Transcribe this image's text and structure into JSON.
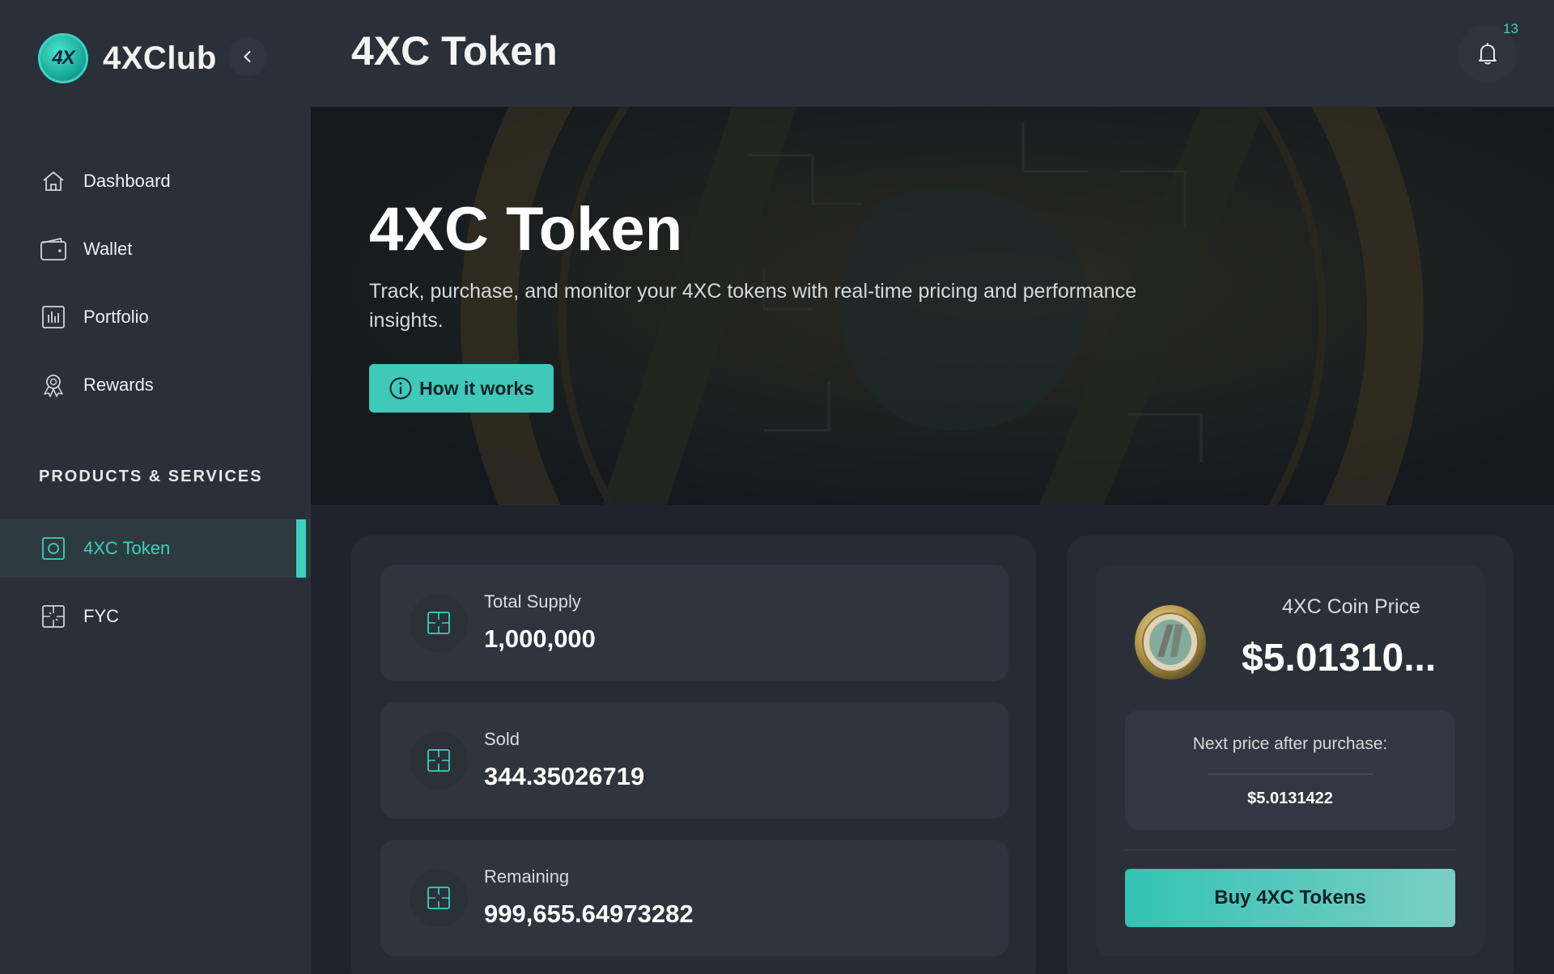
{
  "brand": {
    "logo_text": "4X",
    "name": "4XClub"
  },
  "header": {
    "title": "4XC Token",
    "notification_count": "13"
  },
  "sidebar": {
    "items": [
      {
        "label": "Dashboard",
        "icon": "home-icon"
      },
      {
        "label": "Wallet",
        "icon": "wallet-icon"
      },
      {
        "label": "Portfolio",
        "icon": "chart-icon"
      },
      {
        "label": "Rewards",
        "icon": "award-icon"
      }
    ],
    "section_title": "PRODUCTS & SERVICES",
    "products": [
      {
        "label": "4XC Token",
        "icon": "token-icon",
        "active": true
      },
      {
        "label": "FYC",
        "icon": "grid-icon",
        "active": false
      }
    ]
  },
  "hero": {
    "title": "4XC Token",
    "subtitle": "Track, purchase, and monitor your 4XC tokens with real-time pricing and performance insights.",
    "button_label": "How it works"
  },
  "stats": [
    {
      "label": "Total Supply",
      "value": "1,000,000"
    },
    {
      "label": "Sold",
      "value": "344.35026719"
    },
    {
      "label": "Remaining",
      "value": "999,655.64973282"
    }
  ],
  "price": {
    "label": "4XC Coin Price",
    "value": "$5.01310...",
    "next_label": "Next price after purchase:",
    "next_value": "$5.0131422",
    "buy_label": "Buy 4XC Tokens"
  },
  "colors": {
    "accent": "#3ccfbd",
    "background": "#1f242c",
    "sidebar": "#2a2f38"
  }
}
